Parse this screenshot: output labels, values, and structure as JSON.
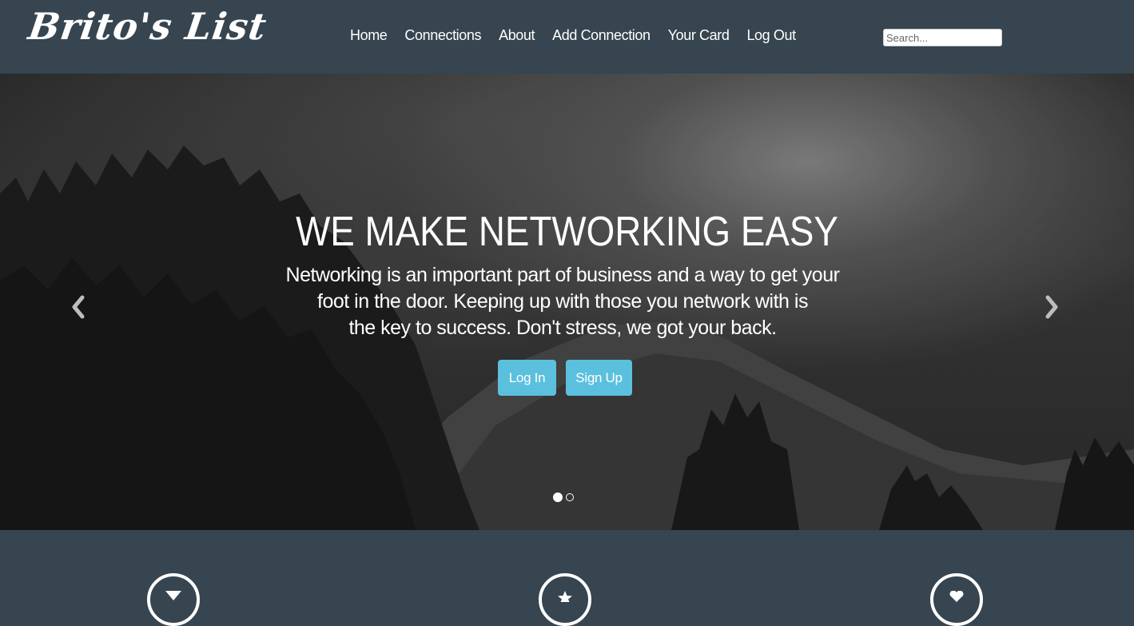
{
  "brand": {
    "name": "Brito's List"
  },
  "nav": {
    "items": [
      {
        "label": "Home"
      },
      {
        "label": "Connections"
      },
      {
        "label": "About"
      },
      {
        "label": "Add Connection"
      },
      {
        "label": "Your Card"
      },
      {
        "label": "Log Out"
      }
    ]
  },
  "search": {
    "placeholder": "Search...",
    "value": ""
  },
  "hero": {
    "title": "WE MAKE NETWORKING EASY",
    "lines": [
      "Networking is an important part of business and a way to get your",
      "foot in the door. Keeping up with those you network with is",
      "the key to success. Don't stress, we got your back."
    ],
    "login_label": "Log In",
    "signup_label": "Sign Up",
    "slides_total": 2,
    "active_slide": 1
  },
  "features": {
    "icons": [
      "hourglass-icon",
      "star-icon",
      "heart-icon"
    ]
  },
  "colors": {
    "navbar": "#36454f",
    "button": "#5bc0de",
    "text": "#ffffff"
  }
}
